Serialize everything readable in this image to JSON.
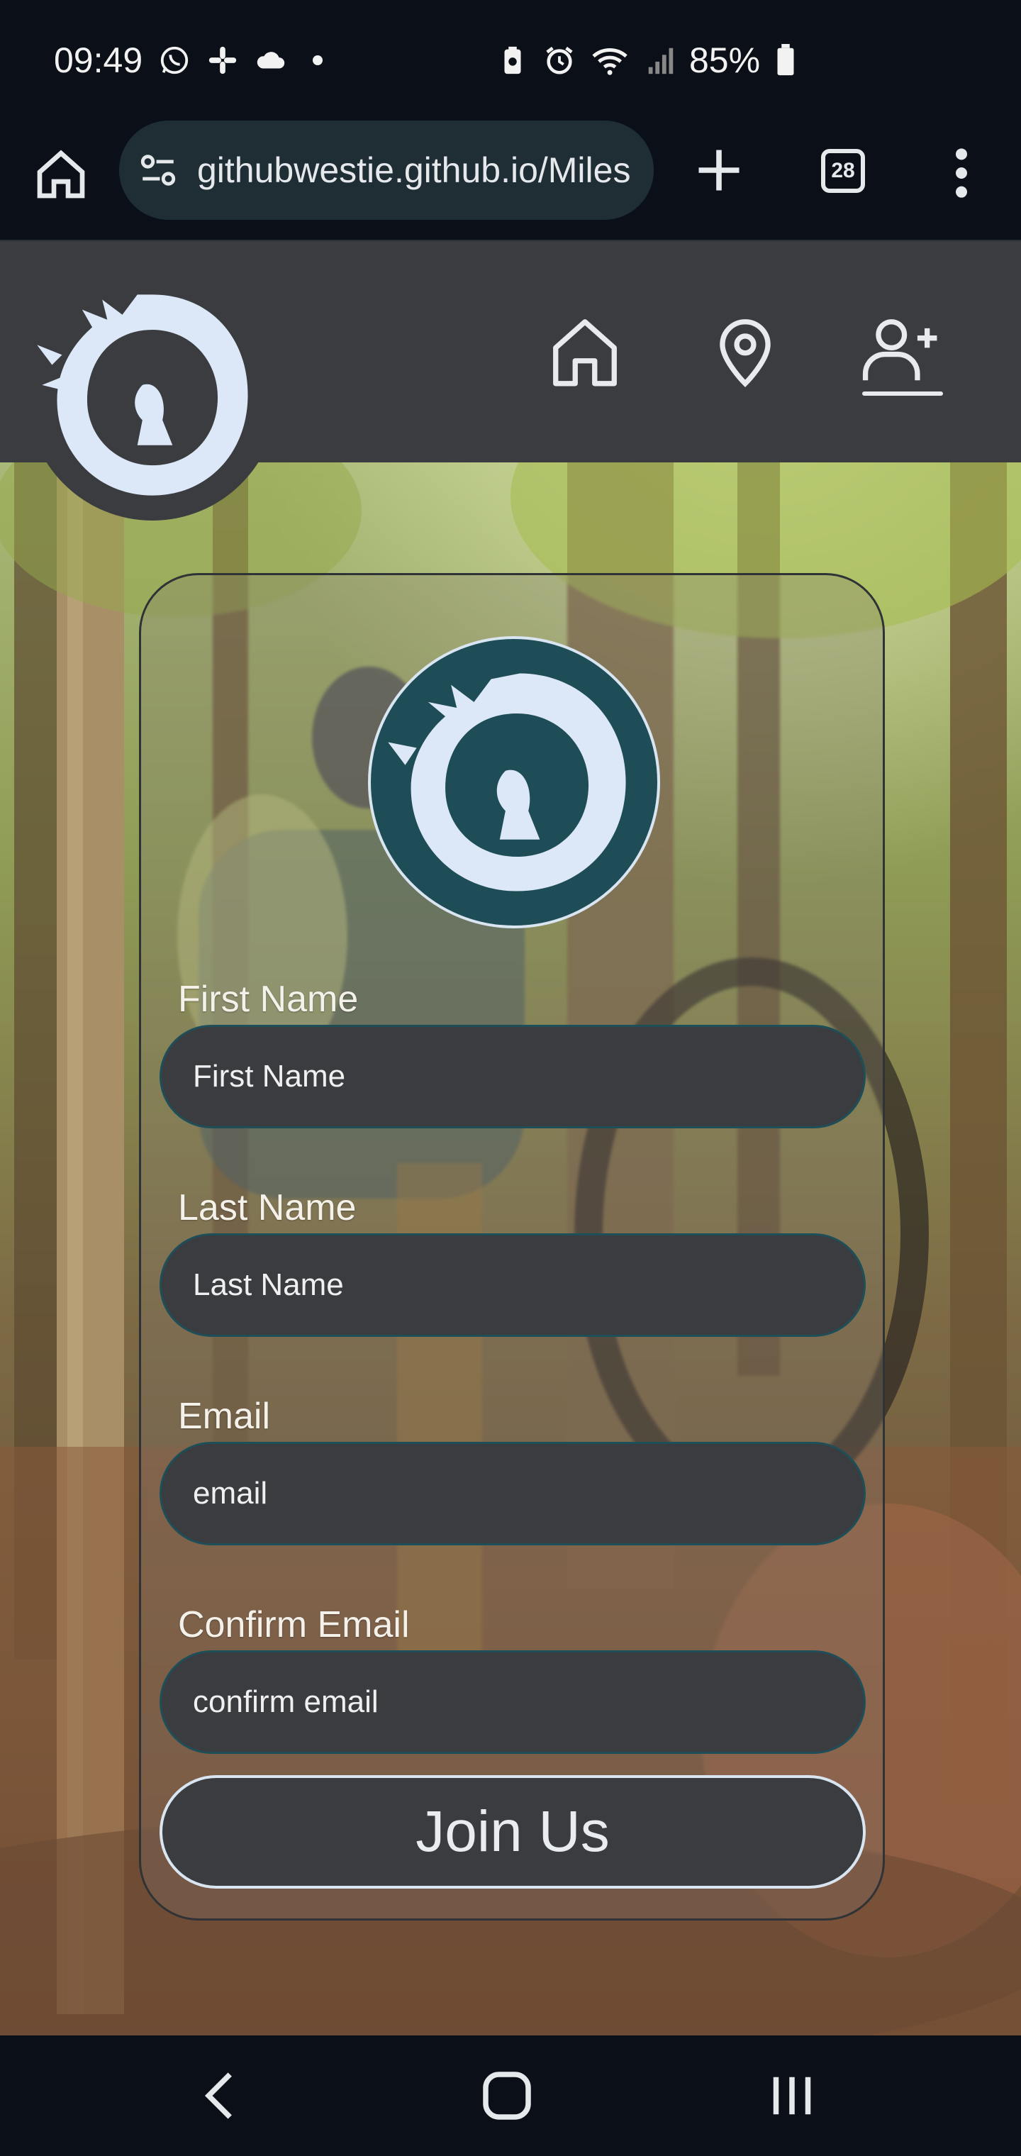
{
  "status_bar": {
    "time": "09:49",
    "battery": "85%",
    "icons": [
      "whatsapp-icon",
      "slack-icon",
      "cloud-icon",
      "dot-icon",
      "battery-saver-icon",
      "alarm-icon",
      "wifi-icon",
      "signal-icon",
      "battery-icon"
    ]
  },
  "browser": {
    "url": "githubwestie.github.io/Miles",
    "tab_count": "28",
    "icons": [
      "home-icon",
      "site-settings-icon",
      "new-tab-icon",
      "tabs-icon",
      "menu-icon"
    ]
  },
  "site_nav": {
    "items": [
      {
        "name": "home",
        "icon": "home-icon"
      },
      {
        "name": "location",
        "icon": "map-pin-icon"
      },
      {
        "name": "join",
        "icon": "user-plus-icon",
        "active": true
      }
    ]
  },
  "form": {
    "fields": [
      {
        "label": "First Name",
        "placeholder": "First Name"
      },
      {
        "label": "Last Name",
        "placeholder": "Last Name"
      },
      {
        "label": "Email",
        "placeholder": "email"
      },
      {
        "label": "Confirm Email",
        "placeholder": "confirm email"
      }
    ],
    "submit_label": "Join Us"
  },
  "colors": {
    "nav_bg": "#3a3c40",
    "logo_teal": "#1f4d57",
    "dragon": "#dce8f8",
    "input_border": "#1e4e58"
  }
}
